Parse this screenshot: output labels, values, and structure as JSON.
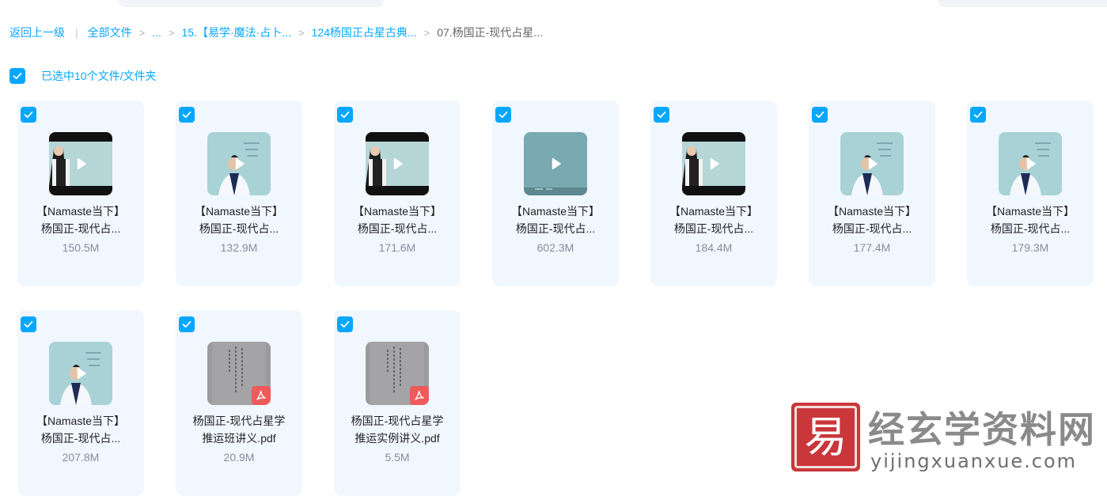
{
  "breadcrumb": {
    "back": "返回上一级",
    "root": "全部文件",
    "ellipsis": "...",
    "level1": "15.【易学·魔法·占卜...",
    "level2": "124杨国正占星古典...",
    "current": "07.杨国正-现代占星..."
  },
  "selection": {
    "label": "已选中10个文件/文件夹",
    "checked": true
  },
  "colors": {
    "accent": "#06a7ff",
    "card_bg": "#f1f7ff",
    "size_text": "#878c9c",
    "pdf_badge": "#ef5a5a"
  },
  "files": [
    {
      "line1": "【Namaste当下】",
      "line2": "杨国正-现代占...",
      "size": "150.5M",
      "type": "video",
      "thumb": "dark",
      "icon": "play-icon"
    },
    {
      "line1": "【Namaste当下】",
      "line2": "杨国正-现代占...",
      "size": "132.9M",
      "type": "video",
      "thumb": "light",
      "icon": "play-icon"
    },
    {
      "line1": "【Namaste当下】",
      "line2": "杨国正-现代占...",
      "size": "171.6M",
      "type": "video",
      "thumb": "dark",
      "icon": "play-icon"
    },
    {
      "line1": "【Namaste当下】",
      "line2": "杨国正-现代占...",
      "size": "602.3M",
      "type": "video",
      "thumb": "blank",
      "icon": "play-icon"
    },
    {
      "line1": "【Namaste当下】",
      "line2": "杨国正-现代占...",
      "size": "184.4M",
      "type": "video",
      "thumb": "dark",
      "icon": "play-icon"
    },
    {
      "line1": "【Namaste当下】",
      "line2": "杨国正-现代占...",
      "size": "177.4M",
      "type": "video",
      "thumb": "light",
      "icon": "play-icon"
    },
    {
      "line1": "【Namaste当下】",
      "line2": "杨国正-现代占...",
      "size": "179.3M",
      "type": "video",
      "thumb": "light",
      "icon": "play-icon"
    },
    {
      "line1": "【Namaste当下】",
      "line2": "杨国正-现代占...",
      "size": "207.8M",
      "type": "video",
      "thumb": "light",
      "icon": "play-icon"
    },
    {
      "line1": "杨国正-现代占星学",
      "line2": "推运班讲义.pdf",
      "size": "20.9M",
      "type": "pdf",
      "thumb": "paper",
      "icon": "pdf-icon"
    },
    {
      "line1": "杨国正-现代占星学",
      "line2": "推运实例讲义.pdf",
      "size": "5.5M",
      "type": "pdf",
      "thumb": "paper",
      "icon": "pdf-icon"
    }
  ],
  "watermark": {
    "seal_char": "易",
    "title": "经玄学资料网",
    "domain": "yijingxuanxue.com"
  }
}
